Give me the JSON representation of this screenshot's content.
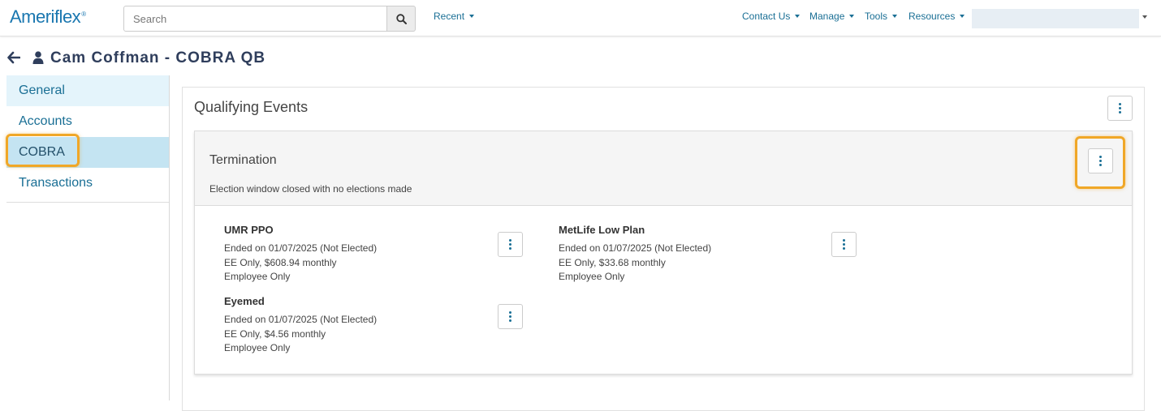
{
  "topbar": {
    "logo": "Ameriflex",
    "logo_mark": "®",
    "search": {
      "placeholder": "Search",
      "value": ""
    },
    "nav_left": [
      {
        "label": "Recent"
      }
    ],
    "nav_right": [
      {
        "label": "Contact Us"
      },
      {
        "label": "Manage"
      },
      {
        "label": "Tools"
      },
      {
        "label": "Resources"
      }
    ]
  },
  "header": {
    "title": "Cam Coffman - COBRA QB"
  },
  "sidebar": {
    "items": [
      {
        "label": "General"
      },
      {
        "label": "Accounts"
      },
      {
        "label": "COBRA",
        "selected": true
      },
      {
        "label": "Transactions"
      }
    ]
  },
  "main": {
    "section_title": "Qualifying Events",
    "event": {
      "title": "Termination",
      "subtitle": "Election window closed with no elections made",
      "plans": [
        {
          "name": "UMR PPO",
          "lines": [
            "Ended on 01/07/2025 (Not Elected)",
            "EE Only, $608.94 monthly",
            "Employee Only"
          ]
        },
        {
          "name": "MetLife Low Plan",
          "lines": [
            "Ended on 01/07/2025 (Not Elected)",
            "EE Only, $33.68 monthly",
            "Employee Only"
          ]
        },
        {
          "name": "Eyemed",
          "lines": [
            "Ended on 01/07/2025 (Not Elected)",
            "EE Only, $4.56 monthly",
            "Employee Only"
          ]
        }
      ]
    }
  },
  "colors": {
    "accent": "#1a6f95",
    "highlight": "#f0a727",
    "selected_bg": "#c4e4f2"
  },
  "icons": [
    "search-icon",
    "back-arrow-icon",
    "user-icon",
    "kebab-icon",
    "caret-down-icon"
  ]
}
